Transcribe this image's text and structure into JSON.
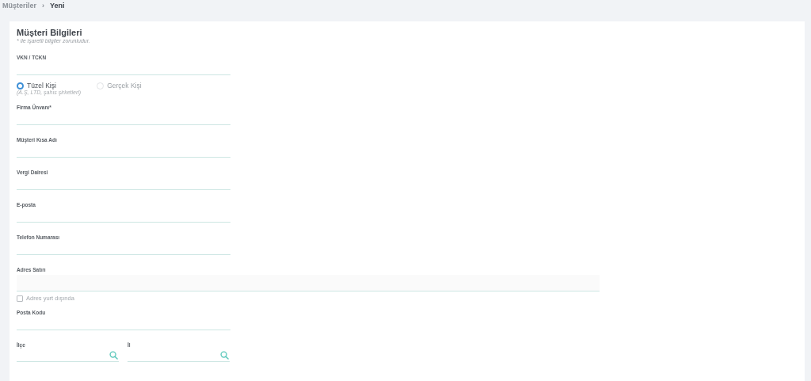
{
  "breadcrumb": {
    "items": [
      {
        "label": "Müşteriler",
        "current": false
      },
      {
        "label": "Yeni",
        "current": true
      }
    ],
    "separator": "›"
  },
  "form": {
    "title": "Müşteri Bilgileri",
    "note": "* ile işaretli bilgiler zorunludur.",
    "fields": [
      {
        "kind": "text",
        "label": "VKN / TCKN"
      },
      {
        "kind": "radio_group",
        "options": [
          {
            "label": "Tüzel Kişi",
            "hint": "(A.Ş, LTD, şahıs şirketleri)",
            "selected": true
          },
          {
            "label": "Gerçek Kişi",
            "selected": false
          }
        ]
      },
      {
        "kind": "text",
        "label": "Firma Ünvanı*"
      },
      {
        "kind": "text",
        "label": "Müşteri Kısa Adı"
      },
      {
        "kind": "text",
        "label": "Vergi Dairesi"
      },
      {
        "kind": "text",
        "label": "E-posta"
      },
      {
        "kind": "text",
        "label": "Telefon Numarası"
      },
      {
        "kind": "textarea",
        "label": "Adres Satırı"
      },
      {
        "kind": "checkbox",
        "label": "Adres yurt dışında",
        "checked": false
      },
      {
        "kind": "text",
        "label": "Posta Kodu"
      },
      {
        "kind": "lookup_pair",
        "items": [
          {
            "label": "İlçe"
          },
          {
            "label": "İl"
          }
        ]
      }
    ]
  }
}
